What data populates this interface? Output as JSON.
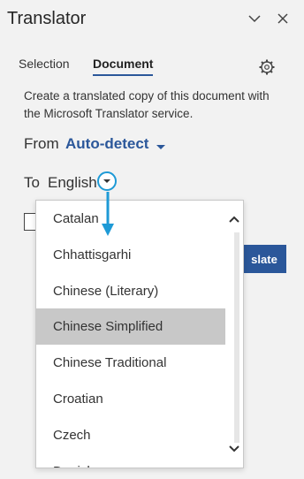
{
  "header": {
    "title": "Translator",
    "chevron_icon": "chevron-down-icon",
    "close_icon": "close-icon"
  },
  "tabs": [
    {
      "label": "Selection"
    },
    {
      "label": "Document"
    }
  ],
  "settings_icon": "gear-icon",
  "description": "Create a translated copy of this document with the Microsoft Translator service.",
  "from": {
    "label": "From",
    "value": "Auto-detect"
  },
  "to": {
    "label": "To",
    "value": "English"
  },
  "translate_button": {
    "label": "slate"
  },
  "dropdown": {
    "options": [
      {
        "label": "Catalan"
      },
      {
        "label": "Chhattisgarhi"
      },
      {
        "label": "Chinese (Literary)"
      },
      {
        "label": "Chinese Simplified"
      },
      {
        "label": "Chinese Traditional"
      },
      {
        "label": "Croatian"
      },
      {
        "label": "Czech"
      },
      {
        "label": "Danish"
      }
    ],
    "selected": "Chinese Simplified"
  },
  "colors": {
    "accent": "#2b579a",
    "highlight": "#1e9ad6",
    "selected_bg": "#c8c8c8"
  }
}
